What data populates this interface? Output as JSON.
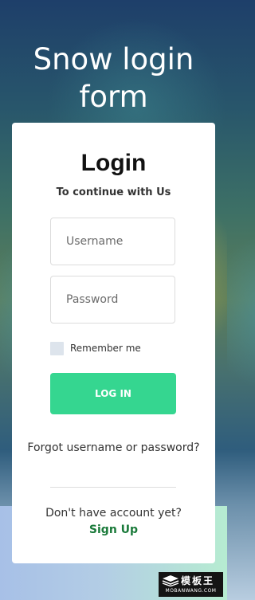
{
  "page": {
    "title": "Snow login form"
  },
  "card": {
    "heading": "Login",
    "subtitle": "To continue with Us",
    "username_placeholder": "Username",
    "password_placeholder": "Password",
    "remember_label": "Remember me",
    "remember_checked": false,
    "login_button": "LOG IN",
    "forgot_link": "Forgot username or password?",
    "no_account_text": "Don't have account yet?",
    "signup_link": "Sign Up"
  },
  "watermark": {
    "cn_text": "模板王",
    "en_text": "MOBANWANG.COM",
    "icon": "stacked-layers-icon"
  },
  "colors": {
    "accent_button": "#35d690",
    "signup_link": "#1a7a3a",
    "card_background": "#ffffff",
    "title_text": "#ffffff"
  }
}
